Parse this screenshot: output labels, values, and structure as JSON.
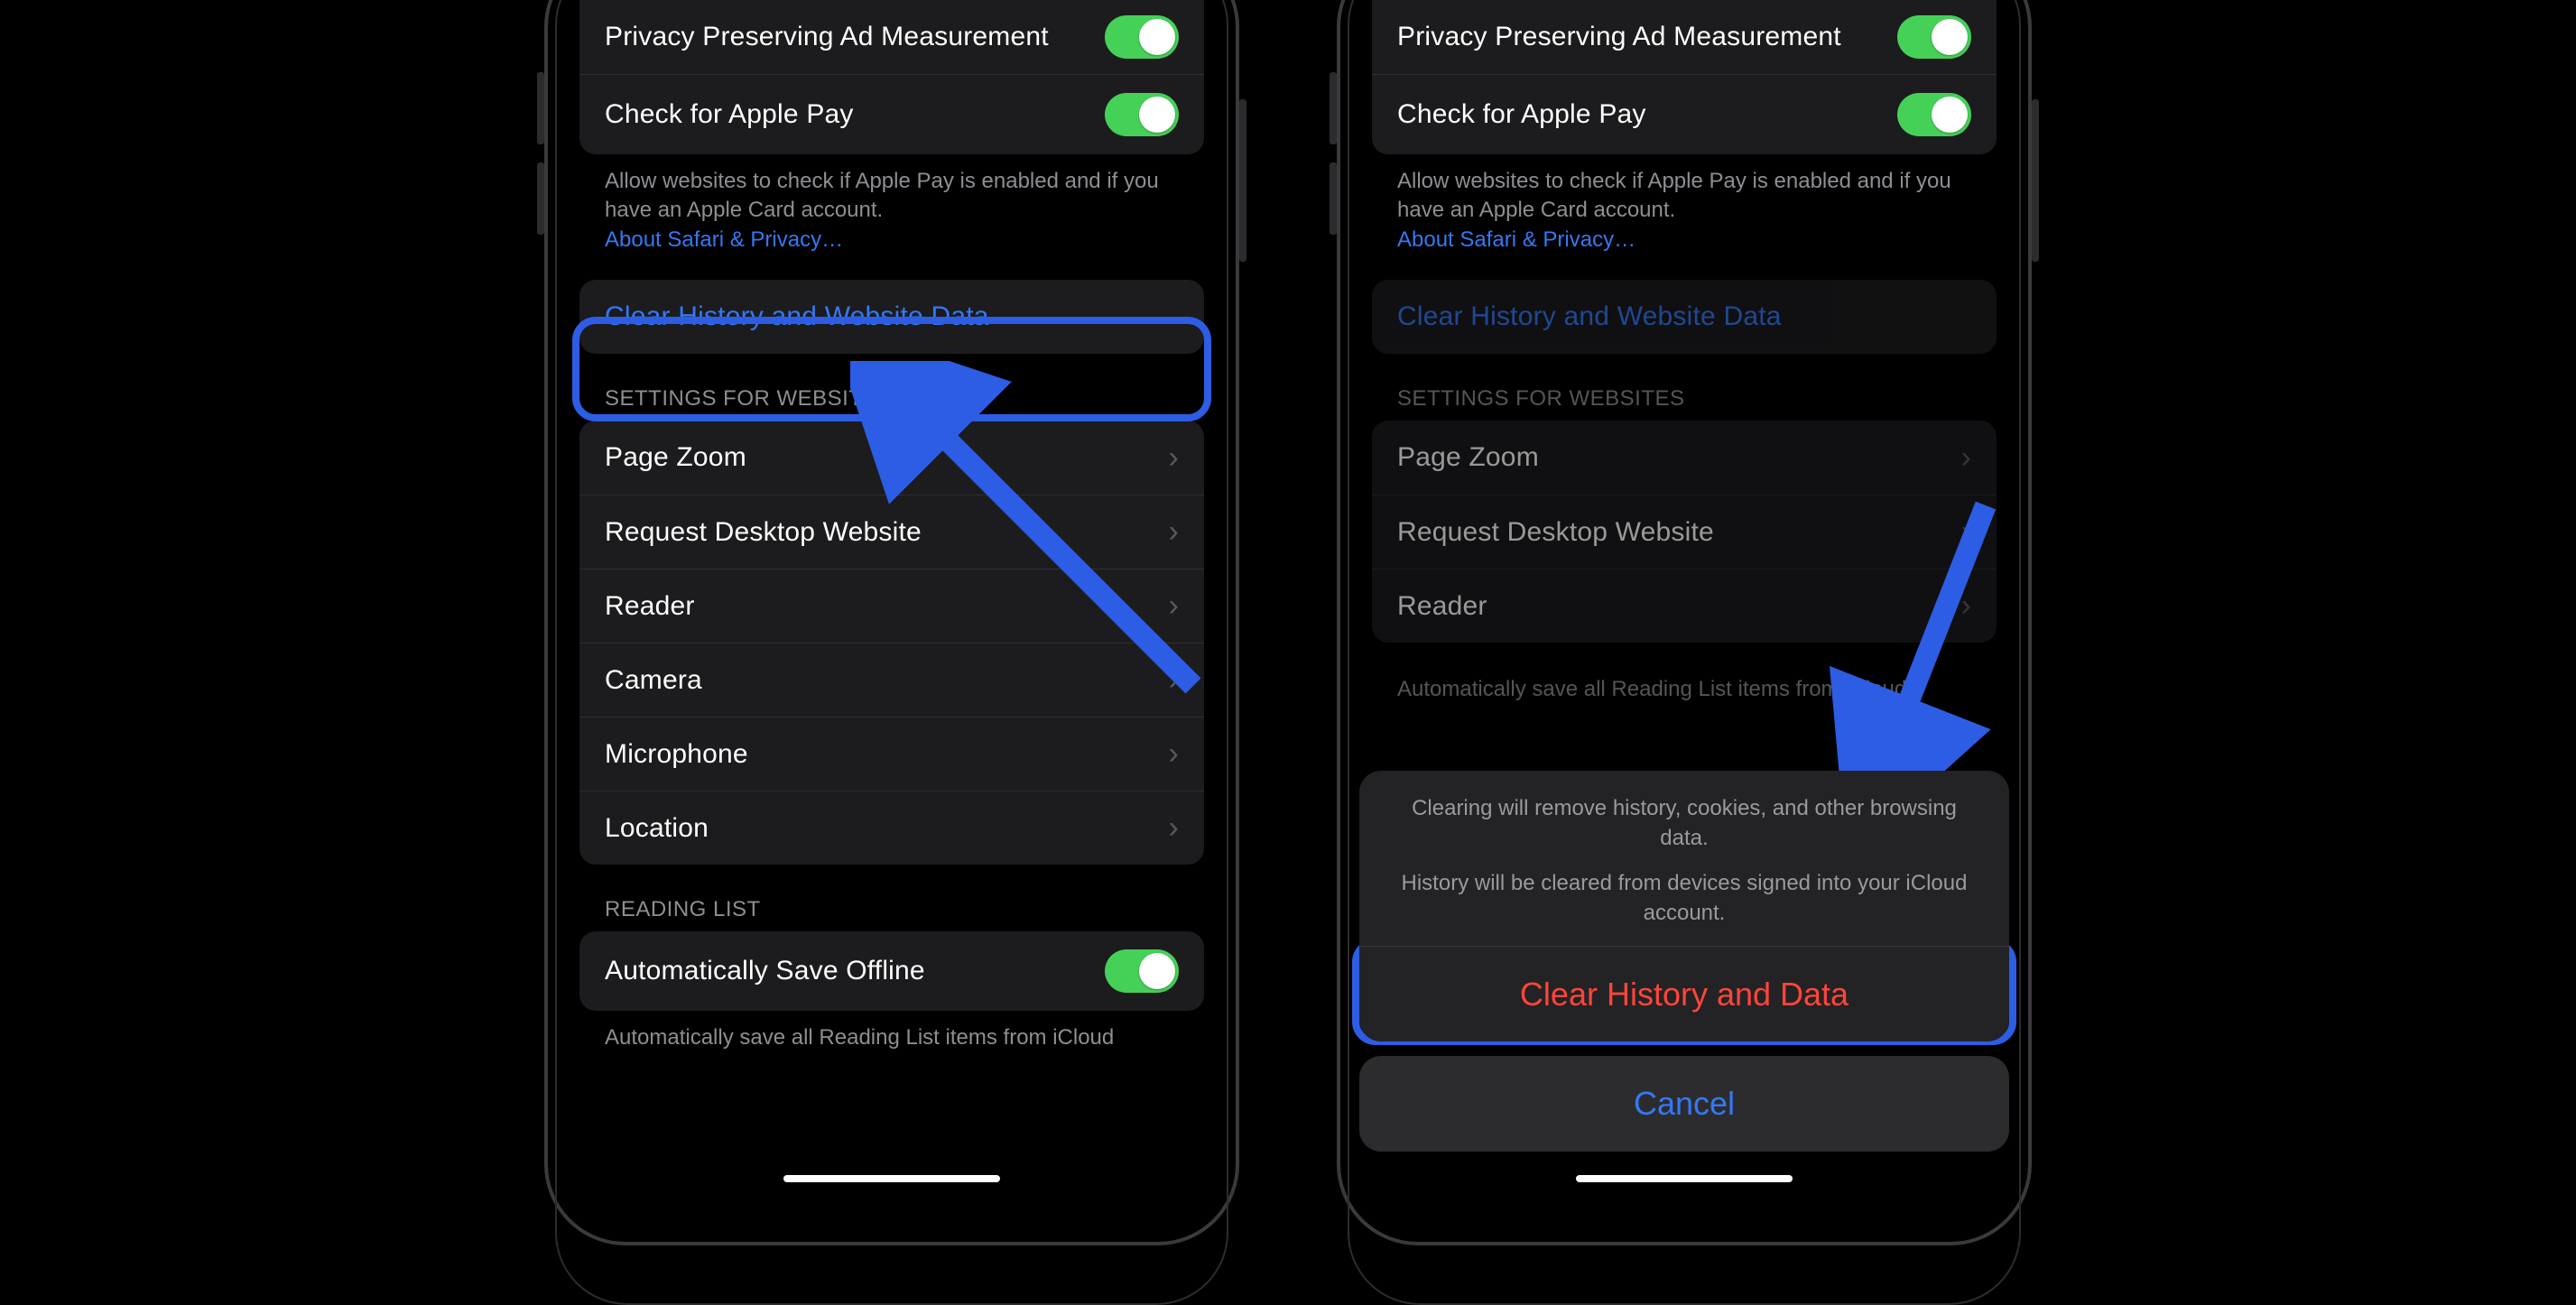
{
  "privacy": {
    "ad_measurement": "Privacy Preserving Ad Measurement",
    "apple_pay": "Check for Apple Pay",
    "footer_text": "Allow websites to check if Apple Pay is enabled and if you have an Apple Card account.",
    "footer_link": "About Safari & Privacy…"
  },
  "clear": {
    "label": "Clear History and Website Data"
  },
  "websites": {
    "header": "SETTINGS FOR WEBSITES",
    "items": [
      "Page Zoom",
      "Request Desktop Website",
      "Reader",
      "Camera",
      "Microphone",
      "Location"
    ]
  },
  "reading": {
    "header": "READING LIST",
    "auto_save": "Automatically Save Offline",
    "footer_text": "Automatically save all Reading List items from iCloud"
  },
  "sheet": {
    "msg1": "Clearing will remove history, cookies, and other browsing data.",
    "msg2": "History will be cleared from devices signed into your iCloud account.",
    "clear_btn": "Clear History and Data",
    "cancel_btn": "Cancel"
  }
}
